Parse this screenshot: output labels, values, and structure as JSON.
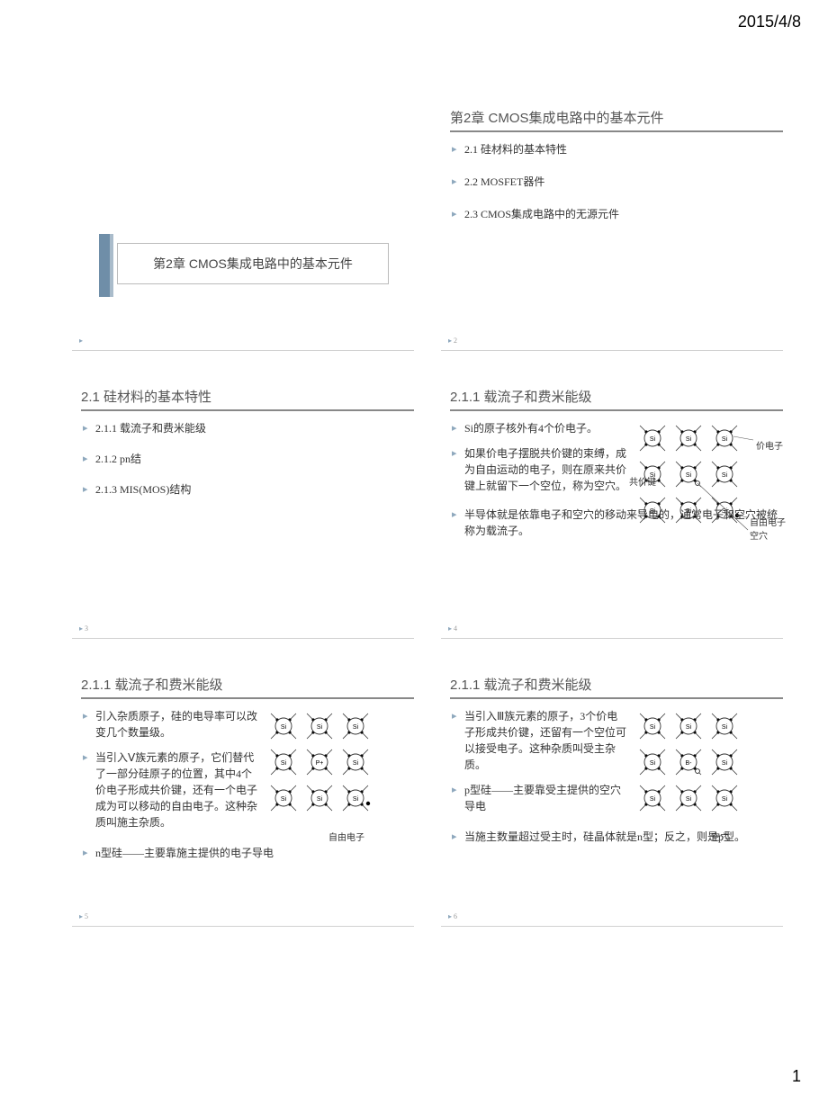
{
  "header": {
    "date": "2015/4/8"
  },
  "footer": {
    "page": "1"
  },
  "slides": {
    "s1": {
      "title": "第2章 CMOS集成电路中的基本元件"
    },
    "s2": {
      "title": "第2章 CMOS集成电路中的基本元件",
      "items": [
        "2.1  硅材料的基本特性",
        "2.2  MOSFET器件",
        "2.3  CMOS集成电路中的无源元件"
      ],
      "num": "2"
    },
    "s3": {
      "title": "2.1  硅材料的基本特性",
      "items": [
        "2.1.1  载流子和费米能级",
        "2.1.2  pn结",
        "2.1.3  MIS(MOS)结构"
      ],
      "num": "3"
    },
    "s4": {
      "title": "2.1.1 载流子和费米能级",
      "items": [
        "Si的原子核外有4个价电子。",
        "如果价电子摆脱共价键的束缚，成为自由运动的电子，则在原来共价键上就留下一个空位，称为空穴。",
        "半导体就是依靠电子和空穴的移动来导电的，通常电子和空穴被统称为载流子。"
      ],
      "labels": {
        "a": "价电子",
        "b": "共价键",
        "c": "自由电子",
        "d": "空穴"
      },
      "num": "4"
    },
    "s5": {
      "title": "2.1.1 载流子和费米能级",
      "items": [
        "引入杂质原子，硅的电导率可以改变几个数量级。",
        "当引入Ⅴ族元素的原子，它们替代了一部分硅原子的位置，其中4个价电子形成共价键，还有一个电子成为可以移动的自由电子。这种杂质叫施主杂质。",
        "n型硅——主要靠施主提供的电子导电"
      ],
      "labels": {
        "a": "自由电子"
      },
      "num": "5"
    },
    "s6": {
      "title": "2.1.1 载流子和费米能级",
      "items": [
        "当引入Ⅲ族元素的原子，3个价电子形成共价键，还留有一个空位可以接受电子。这种杂质叫受主杂质。",
        "p型硅——主要靠受主提供的空穴导电",
        "当施主数量超过受主时，硅晶体就是n型；反之，则是p型。"
      ],
      "labels": {
        "a": "空穴"
      },
      "num": "6"
    }
  },
  "lattice": {
    "atom": "Si",
    "donor": "P+",
    "acceptor": "B-"
  }
}
